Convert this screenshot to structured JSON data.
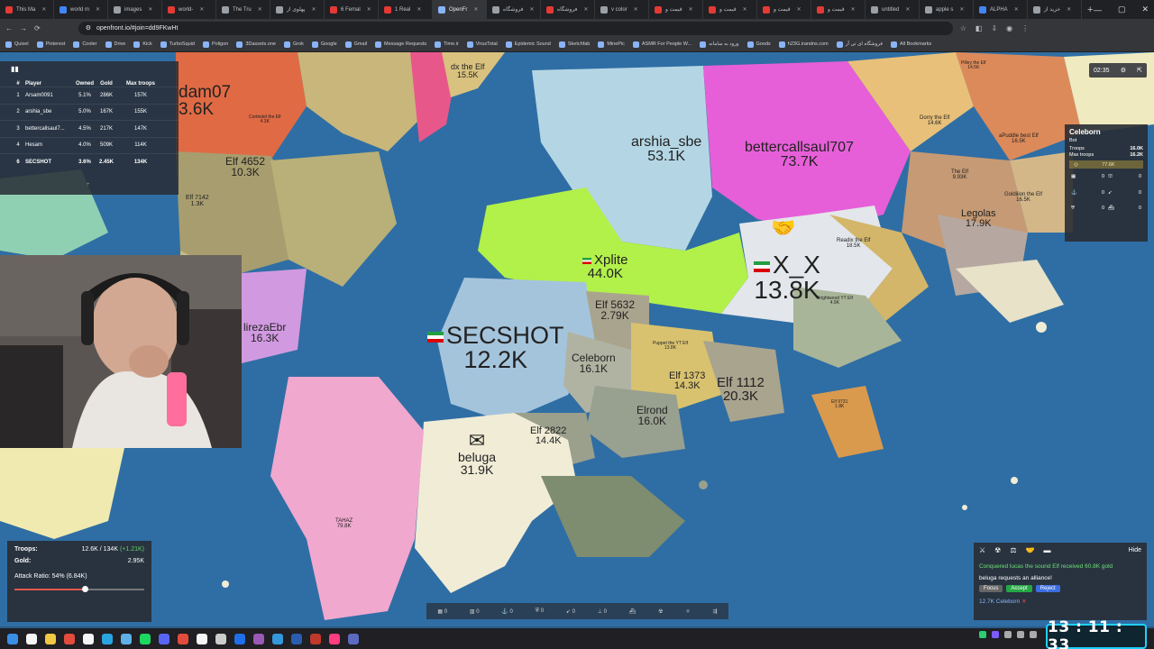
{
  "browser": {
    "tabs": [
      {
        "title": "This Ma",
        "color": "#e53935"
      },
      {
        "title": "world m",
        "color": "#4285f4"
      },
      {
        "title": "images",
        "color": "#9aa0a6"
      },
      {
        "title": "world-",
        "color": "#e53935"
      },
      {
        "title": "The Tru",
        "color": "#9aa0a6"
      },
      {
        "title": "پهلوی از",
        "color": "#9aa0a6"
      },
      {
        "title": "6 Femal",
        "color": "#e53935"
      },
      {
        "title": "1 Real",
        "color": "#e53935"
      },
      {
        "title": "OpenFr",
        "color": "#8ab4f8",
        "active": true
      },
      {
        "title": "فروشگاه",
        "color": "#9aa0a6"
      },
      {
        "title": "فروشگاه",
        "color": "#e53935"
      },
      {
        "title": "v color",
        "color": "#9aa0a6"
      },
      {
        "title": "قیمت و",
        "color": "#e53935"
      },
      {
        "title": "قیمت و",
        "color": "#e53935"
      },
      {
        "title": "قیمت و",
        "color": "#e53935"
      },
      {
        "title": "قیمت و",
        "color": "#e53935"
      },
      {
        "title": "untitled",
        "color": "#9aa0a6"
      },
      {
        "title": "apple s",
        "color": "#9aa0a6"
      },
      {
        "title": "ALPHA",
        "color": "#4285f4"
      },
      {
        "title": "خرید از",
        "color": "#9aa0a6"
      }
    ],
    "url": "openfront.io/#join=dd9FKwHt",
    "bookmarks": [
      "Quixel",
      "Pinterest",
      "Cooler",
      "Drive",
      "Kick",
      "TurboSquid",
      "Poligon",
      "3Dassets.one",
      "Grok",
      "Google",
      "Gmail",
      "Message Requests",
      "Time.ir",
      "VirusTotal",
      "Epidemic Sound",
      "Sketchfab",
      "MinePic",
      "ASMR For People W...",
      "ورود به سامانه",
      "Goods",
      "h23G.irandns.com",
      "فروشگاه ای تی آر",
      "All Bookmarks"
    ]
  },
  "leaderboard": {
    "headers": [
      "#",
      "Player",
      "Owned",
      "Gold",
      "Max troops"
    ],
    "rows": [
      {
        "rank": "1",
        "player": "Arsam0091",
        "owned": "5.1%",
        "gold": "286K",
        "max": "157K"
      },
      {
        "rank": "2",
        "player": "arshia_sbe",
        "owned": "5.0%",
        "gold": "167K",
        "max": "155K"
      },
      {
        "rank": "3",
        "player": "bettercallsaul7...",
        "owned": "4.5%",
        "gold": "217K",
        "max": "147K"
      },
      {
        "rank": "4",
        "player": "Hesam",
        "owned": "4.0%",
        "gold": "509K",
        "max": "114K"
      },
      {
        "rank": "6",
        "player": "SECSHOT",
        "owned": "3.6%",
        "gold": "2.45K",
        "max": "134K"
      }
    ],
    "footer": "+"
  },
  "map": {
    "territories": [
      {
        "name": "Arsam0091",
        "troops": "3.6K",
        "shown_name": "dam07",
        "shown_troops": "3.6K"
      },
      {
        "name": "dx the Elf",
        "troops": "15.5K"
      },
      {
        "name": "arshia_sbe",
        "troops": "53.1K"
      },
      {
        "name": "bettercallsaul707",
        "troops": "73.7K"
      },
      {
        "name": "Elf 4652",
        "troops": "10.3K"
      },
      {
        "name": "Xplite",
        "troops": "44.0K"
      },
      {
        "name": "X_X",
        "troops": "13.8K"
      },
      {
        "name": "SECSHOT",
        "troops": "12.2K"
      },
      {
        "name": "Elf 5632",
        "troops": "2.79K"
      },
      {
        "name": "Celeborn",
        "troops": "16.1K"
      },
      {
        "name": "Elf 1373",
        "troops": "14.3K"
      },
      {
        "name": "Elf 1112",
        "troops": "20.3K"
      },
      {
        "name": "Elrond",
        "troops": "16.0K"
      },
      {
        "name": "Elf 2822",
        "troops": "14.4K"
      },
      {
        "name": "beluga",
        "troops": "31.9K"
      },
      {
        "name": "lirezaEbr",
        "troops": "16.3K"
      },
      {
        "name": "Legolas",
        "troops": "17.9K"
      },
      {
        "name": "Elf 7142",
        "troops": "1.3K"
      },
      {
        "name": "Cortindel the Elf",
        "troops": "4.3K"
      },
      {
        "name": "Dorry the Elf",
        "troops": "14.6K"
      },
      {
        "name": "aPuddle best Elf",
        "troops": "16.5K"
      },
      {
        "name": "Goldilion the Elf",
        "troops": "16.5K"
      },
      {
        "name": "The Elf",
        "troops": "9.93K"
      },
      {
        "name": "Readix the Elf",
        "troops": "18.5K"
      },
      {
        "name": "Brightwood YT Elf",
        "troops": "4.9K"
      },
      {
        "name": "Elf 9731",
        "troops": "1.8K"
      },
      {
        "name": "TAHAZ",
        "troops": "79.8K"
      },
      {
        "name": "Pilley the Elf",
        "troops": "14.5K"
      },
      {
        "name": "Puppet the YT Elf",
        "troops": "13.8K"
      }
    ]
  },
  "right_panel": {
    "timer": "02:35",
    "player_name": "Celeborn",
    "type": "Bot",
    "troops_label": "Troops",
    "troops": "16.0K",
    "max_troops_label": "Max troops",
    "max_troops": "16.2K",
    "gold": "77.6K",
    "units": [
      "0",
      "0",
      "0",
      "0",
      "0",
      "0"
    ]
  },
  "troops_panel": {
    "troops_label": "Troops:",
    "troops_value": "12.6K / 134K",
    "troops_rate": "(+1.21K)",
    "gold_label": "Gold:",
    "gold_value": "2.95K",
    "attack_ratio_label": "Attack Ratio: 54% (6.84K)",
    "attack_ratio": 0.54
  },
  "bottom_bar": [
    "0",
    "0",
    "0",
    "0",
    "0",
    "0"
  ],
  "events": {
    "hide": "Hide",
    "conquered": "Conquered lucas the sound Elf received 60.8K gold",
    "alliance": "beluga requests an alliance!",
    "focus": "Focus",
    "accept": "Accept",
    "reject": "Reject",
    "attack": "12.7K Celeborn"
  },
  "clock": "13 : 11 : 33"
}
